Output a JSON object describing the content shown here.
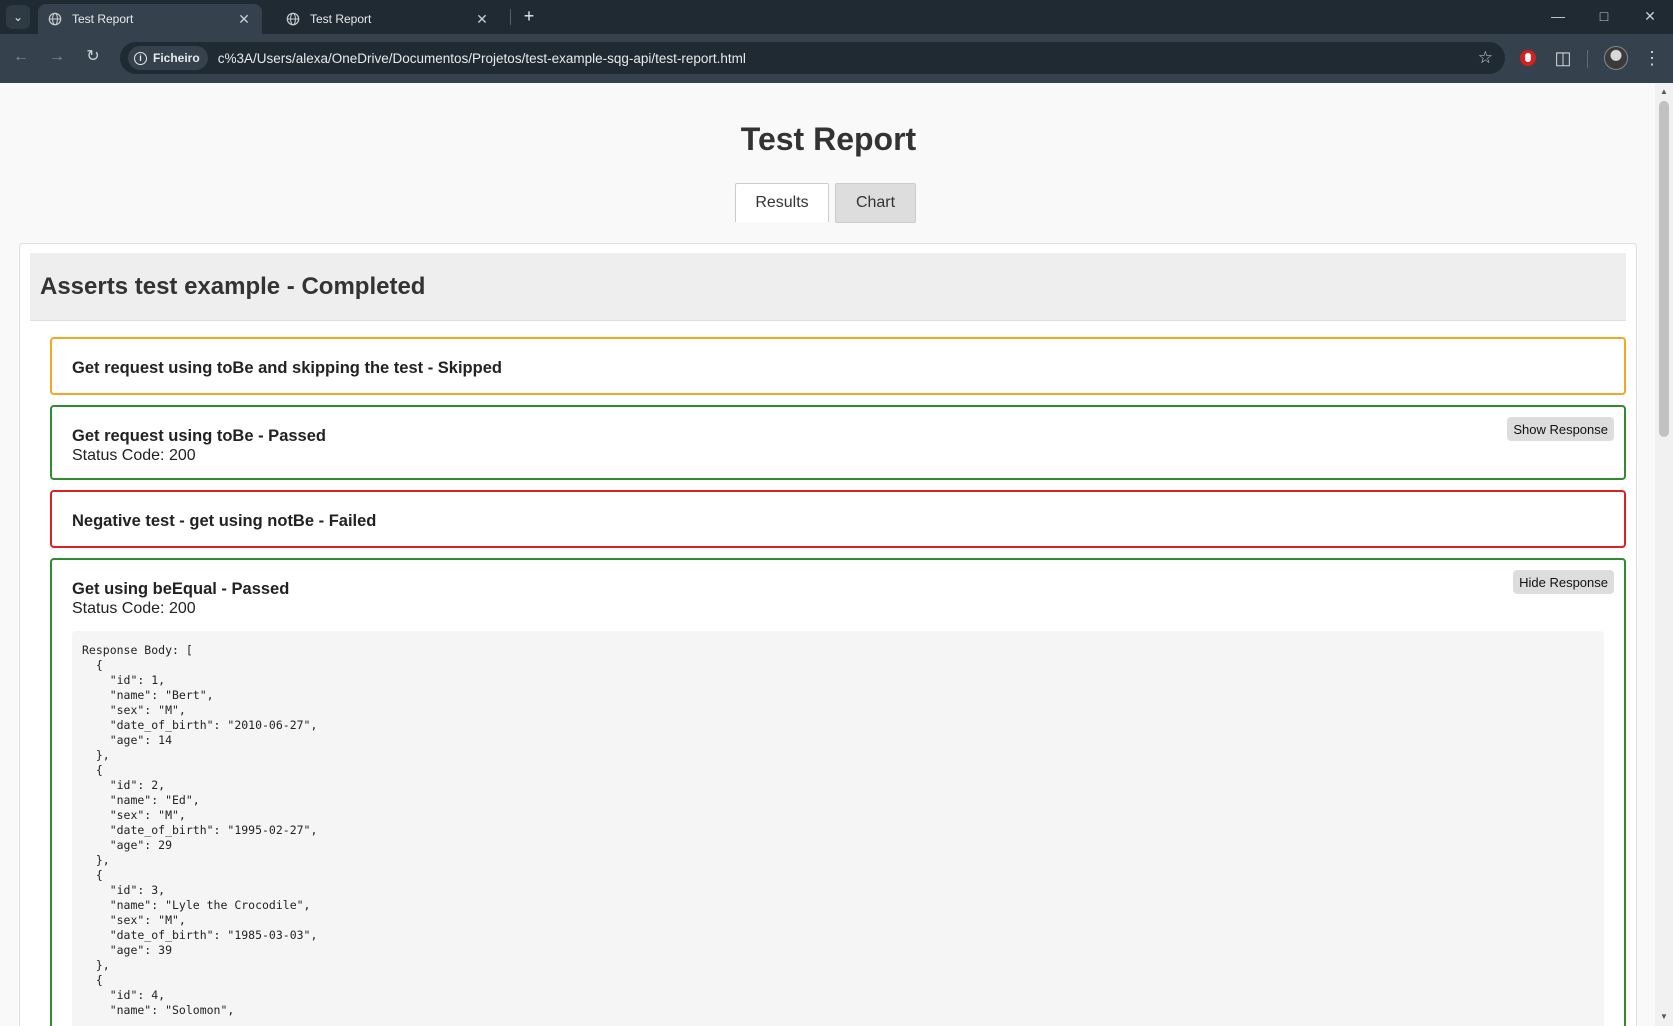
{
  "browser": {
    "tabs": [
      {
        "title": "Test Report",
        "active": true
      },
      {
        "title": "Test Report",
        "active": false
      }
    ],
    "address": {
      "chip_label": "Ficheiro",
      "url": "c%3A/Users/alexa/OneDrive/Documentos/Projetos/test-example-sqg-api/test-report.html"
    },
    "icons": [
      "tab-search-icon",
      "globe-icon",
      "close-icon",
      "plus-icon",
      "minimize-icon",
      "maximize-icon",
      "window-close-icon",
      "back-arrow-icon",
      "forward-arrow-icon",
      "reload-icon",
      "info-icon",
      "star-icon",
      "extension-red-icon",
      "puzzle-icon",
      "avatar",
      "kebab-menu-icon"
    ]
  },
  "report": {
    "title": "Test Report",
    "tabs": [
      {
        "label": "Results",
        "active": true
      },
      {
        "label": "Chart",
        "active": false
      }
    ],
    "suite": {
      "title": "Asserts test example - Completed"
    },
    "tests": [
      {
        "name": "Get request using toBe and skipping the test - Skipped",
        "status": "skipped",
        "color": "#f5a623"
      },
      {
        "name": "Get request using toBe - Passed",
        "status": "passed",
        "status_code": "Status Code: 200",
        "button": "Show Response",
        "color": "#2e8b2e"
      },
      {
        "name": "Negative test - get using notBe - Failed",
        "status": "failed",
        "color": "#e02020"
      },
      {
        "name": "Get using beEqual - Passed",
        "status": "passed",
        "status_code": "Status Code: 200",
        "button": "Hide Response",
        "color": "#2e8b2e",
        "response_body": "Response Body: [\n  {\n    \"id\": 1,\n    \"name\": \"Bert\",\n    \"sex\": \"M\",\n    \"date_of_birth\": \"2010-06-27\",\n    \"age\": 14\n  },\n  {\n    \"id\": 2,\n    \"name\": \"Ed\",\n    \"sex\": \"M\",\n    \"date_of_birth\": \"1995-02-27\",\n    \"age\": 29\n  },\n  {\n    \"id\": 3,\n    \"name\": \"Lyle the Crocodile\",\n    \"sex\": \"M\",\n    \"date_of_birth\": \"1985-03-03\",\n    \"age\": 39\n  },\n  {\n    \"id\": 4,\n    \"name\": \"Solomon\","
      }
    ]
  }
}
